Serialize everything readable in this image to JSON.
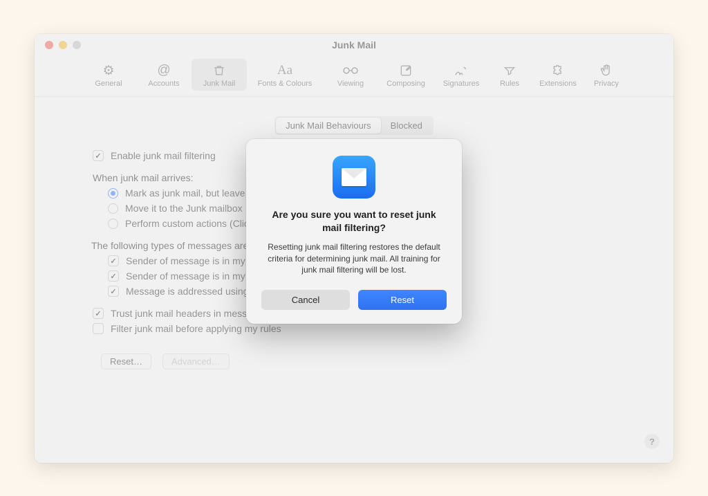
{
  "window": {
    "title": "Junk Mail"
  },
  "toolbar": {
    "items": [
      {
        "label": "General"
      },
      {
        "label": "Accounts"
      },
      {
        "label": "Junk Mail"
      },
      {
        "label": "Fonts & Colours"
      },
      {
        "label": "Viewing"
      },
      {
        "label": "Composing"
      },
      {
        "label": "Signatures"
      },
      {
        "label": "Rules"
      },
      {
        "label": "Extensions"
      },
      {
        "label": "Privacy"
      }
    ]
  },
  "segmented": {
    "behaviours": "Junk Mail Behaviours",
    "blocked": "Blocked"
  },
  "prefs": {
    "enable": "Enable junk mail filtering",
    "when_label": "When junk mail arrives:",
    "opt_mark": "Mark as junk mail, but leave it in my Inbox",
    "opt_move": "Move it to the Junk mailbox",
    "opt_custom": "Perform custom actions (Click Advanced to configure)",
    "exempt_label": "The following types of messages are exempt from junk mail filtering:",
    "exempt_contacts": "Sender of message is in my Contacts",
    "exempt_prev": "Sender of message is in my Previous Recipients",
    "exempt_fullname": "Message is addressed using my full name",
    "trust_headers": "Trust junk mail headers in messages",
    "filter_before_rules": "Filter junk mail before applying my rules",
    "reset": "Reset…",
    "advanced": "Advanced…"
  },
  "help": {
    "label": "?"
  },
  "dialog": {
    "title": "Are you sure you want to reset junk mail filtering?",
    "message": "Resetting junk mail filtering restores the default criteria for determining junk mail. All training for junk mail filtering will be lost.",
    "cancel": "Cancel",
    "reset": "Reset"
  }
}
